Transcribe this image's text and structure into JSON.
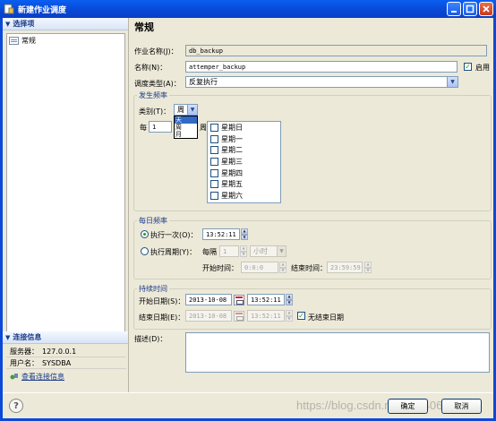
{
  "window": {
    "title": "新建作业调度"
  },
  "sidebar": {
    "header": "选择项",
    "items": [
      {
        "label": "常规"
      }
    ],
    "conn_header": "连接信息",
    "conn": [
      {
        "label": "服务器：",
        "value": "127.0.0.1"
      },
      {
        "label": "用户名：",
        "value": "SYSDBA"
      }
    ],
    "conn_link": "查看连接信息"
  },
  "general": {
    "title": "常规",
    "job_name_label": "作业名称(J)：",
    "job_name_value": "db_backup",
    "name_label": "名称(N)：",
    "name_value": "attemper_backup",
    "enabled_label": "启用",
    "schedule_type_label": "调度类型(A)：",
    "schedule_type_value": "反复执行"
  },
  "frequency": {
    "group_title": "发生频率",
    "category_label": "类别(T)：",
    "category_value": "周",
    "category_options": [
      "天",
      "周",
      "月"
    ],
    "every_label": "每",
    "every_value": "1",
    "every_suffix": "周",
    "weekdays": [
      "星期日",
      "星期一",
      "星期二",
      "星期三",
      "星期四",
      "星期五",
      "星期六"
    ]
  },
  "daily": {
    "group_title": "每日频率",
    "once_label": "执行一次(O)：",
    "once_time": "13:52:11",
    "periodic_label": "执行周期(Y)：",
    "every_label": "每隔",
    "interval_value": "1",
    "interval_unit": "小时",
    "start_label": "开始时间：",
    "start_time": "0:0:0",
    "end_label": "结束时间：",
    "end_time": "23:59:59"
  },
  "duration": {
    "group_title": "持续时间",
    "start_date_label": "开始日期(S)：",
    "start_date": "2013-10-08",
    "start_time": "13:52:11",
    "end_date_label": "结束日期(E)：",
    "end_date": "2013-10-08",
    "end_time": "13:52:11",
    "no_end_label": "无结束日期"
  },
  "description": {
    "label": "描述(D)：",
    "value": ""
  },
  "buttons": {
    "ok": "确定",
    "cancel": "取消"
  },
  "watermark": "https://blog.csdn.net/qq_40656"
}
